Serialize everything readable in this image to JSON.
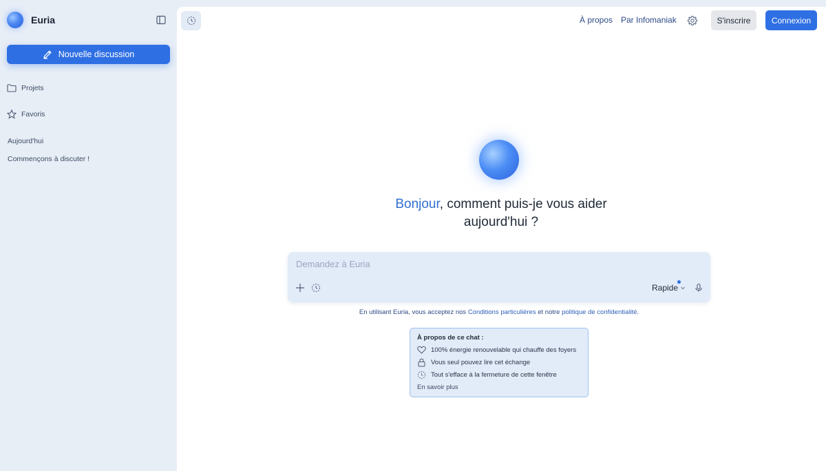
{
  "brand": {
    "name": "Euria"
  },
  "sidebar": {
    "new_chat_label": "Nouvelle discussion",
    "projects_label": "Projets",
    "favorites_label": "Favoris",
    "today_heading": "Aujourd'hui",
    "conversation_title": "Commençons à discuter !"
  },
  "header": {
    "about_link": "À propos",
    "by_link": "Par Infomaniak",
    "signup_label": "S'inscrire",
    "login_label": "Connexion"
  },
  "hero": {
    "greeting_highlight": "Bonjour",
    "greeting_rest": ", comment puis-je vous aider aujourd'hui ?"
  },
  "composer": {
    "placeholder": "Demandez à Euria",
    "model_label": "Rapide"
  },
  "terms": {
    "prefix": "En utilisant Euria, vous acceptez nos ",
    "conditions_link": "Conditions particulières",
    "middle": " et notre ",
    "privacy_link": "politique de confidentialité",
    "suffix": "."
  },
  "about_chat": {
    "title": "À propos de ce chat :",
    "items": [
      "100% énergie renouvelable qui chauffe des foyers",
      "Vous seul pouvez lire cet échange",
      "Tout s'efface à la fermeture de cette fenêtre"
    ],
    "learn_more": "En savoir plus"
  },
  "colors": {
    "accent": "#2f6fe4",
    "sidebar_bg": "#e8eef6",
    "composer_bg": "#e2ebf8"
  },
  "icons": [
    "sidebar-toggle-icon",
    "pencil-icon",
    "folder-icon",
    "star-icon",
    "history-icon",
    "gear-icon",
    "plus-icon",
    "chevron-down-icon",
    "microphone-icon",
    "heart-icon",
    "lock-icon",
    "dashed-clock-icon"
  ]
}
